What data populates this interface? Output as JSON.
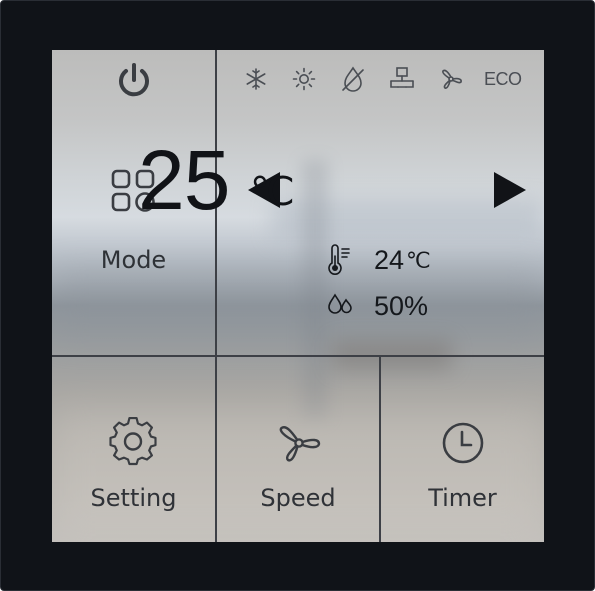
{
  "panel": {
    "power_icon": "power-icon",
    "mode": {
      "label": "Mode",
      "icon": "grid-icon"
    },
    "setting": {
      "label": "Setting",
      "icon": "gear-icon"
    },
    "speed": {
      "label": "Speed",
      "icon": "fan-icon"
    },
    "timer": {
      "label": "Timer",
      "icon": "clock-icon"
    }
  },
  "mode_bar": {
    "icons": [
      "snowflake-icon",
      "sun-icon",
      "dry-drop-icon",
      "ventilation-icon",
      "fan-icon"
    ],
    "eco_label": "ECO"
  },
  "climate": {
    "set_temperature": "25",
    "set_unit": "℃",
    "room_temperature": "24",
    "room_temperature_unit": "℃",
    "humidity": "50%",
    "decrease_icon": "left-triangle-icon",
    "increase_icon": "right-triangle-icon",
    "thermometer_icon": "thermometer-icon",
    "humidity_icon": "humidity-drops-icon"
  },
  "colors": {
    "bezel": "#101318",
    "divider": "#3d4046",
    "text": "#2f3237",
    "value_text": "#111317"
  }
}
